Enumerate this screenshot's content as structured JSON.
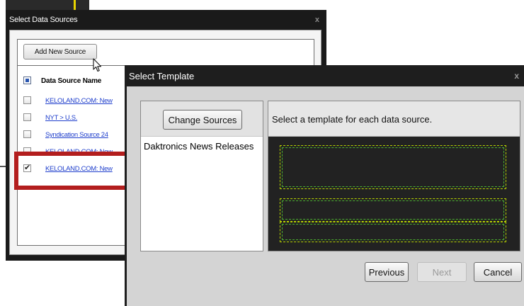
{
  "data_sources_window": {
    "title": "Select Data Sources",
    "close_label": "x",
    "add_button_label": "Add New Source",
    "column_header": "Data Source Name",
    "rows": [
      {
        "label": "KELOLAND.COM: New",
        "checked": false
      },
      {
        "label": "NYT > U.S.",
        "checked": false
      },
      {
        "label": "Syndication Source 24",
        "checked": false
      },
      {
        "label": "KELOLAND.COM: New",
        "checked": false
      },
      {
        "label": "KELOLAND.COM: New",
        "checked": true
      }
    ],
    "highlight_color": "#b31e1e"
  },
  "template_dialog": {
    "title": "Select Template",
    "close_label": "x",
    "change_sources_label": "Change Sources",
    "source_items": [
      "Daktronics News Releases"
    ],
    "instructions": "Select a template for each data source.",
    "buttons": {
      "previous": "Previous",
      "next": "Next",
      "cancel": "Cancel"
    },
    "next_enabled": false,
    "zone_colors": [
      "#b8d400",
      "#4caf30"
    ]
  },
  "icons": {
    "cursor": "mouse-pointer-icon",
    "checkmark": "checkmark-icon"
  }
}
